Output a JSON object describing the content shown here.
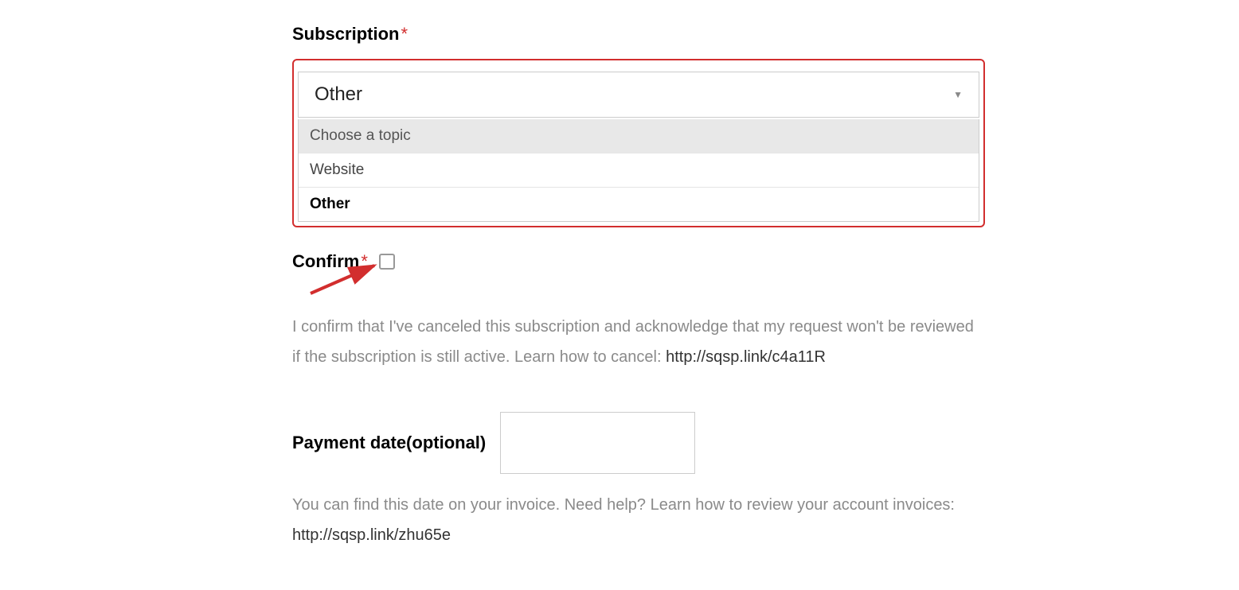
{
  "subscription": {
    "label": "Subscription",
    "selected_value": "Other",
    "options": [
      {
        "label": "Choose a topic",
        "type": "placeholder"
      },
      {
        "label": "Website",
        "type": "normal"
      },
      {
        "label": "Other",
        "type": "selected"
      }
    ]
  },
  "confirm": {
    "label": "Confirm",
    "description_before": "I confirm that I've canceled this subscription and acknowledge that my request won't be reviewed if the subscription is still active. Learn how to cancel: ",
    "link": "http://sqsp.link/c4a11R"
  },
  "payment": {
    "label": "Payment date(optional)",
    "description_before": "You can find this date on your invoice. Need help? Learn how to review your account invoices: ",
    "link": "http://sqsp.link/zhu65e"
  }
}
